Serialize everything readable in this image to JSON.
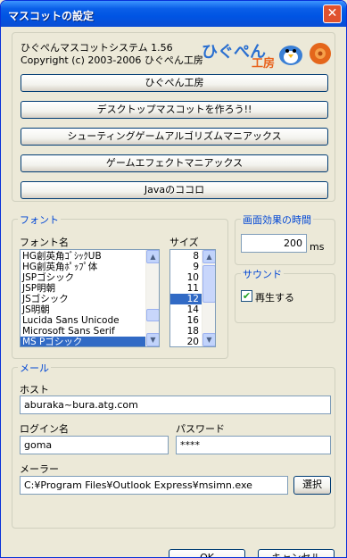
{
  "window": {
    "title": "マスコットの設定",
    "close": "✕"
  },
  "about": {
    "app_name": "ひぐぺんマスコットシステム 1.56",
    "copyright": "Copyright (c) 2003-2006 ひぐぺん工房",
    "logo_text_1": "ひぐぺん",
    "logo_text_2": "工房",
    "buttons": [
      "ひぐぺん工房",
      "デスクトップマスコットを作ろう!!",
      "シューティングゲームアルゴリズムマニアックス",
      "ゲームエフェクトマニアックス",
      "Javaのココロ"
    ]
  },
  "font": {
    "group_label": "フォント",
    "name_label": "フォント名",
    "size_label": "サイズ",
    "fonts": [
      "HG創英角ｺﾞｼｯｸUB",
      "HG創英角ﾎﾟｯﾌﾟ体",
      "JSPゴシック",
      "JSP明朝",
      "JSゴシック",
      "JS明朝",
      "Lucida Sans Unicode",
      "Microsoft Sans Serif",
      "MS Pゴシック"
    ],
    "selected_font": "MS Pゴシック",
    "sizes": [
      "8",
      "9",
      "10",
      "11",
      "12",
      "14",
      "16",
      "18",
      "20"
    ],
    "selected_size": "12"
  },
  "effect": {
    "group_label": "画面効果の時間",
    "value": "200",
    "unit": "ms"
  },
  "sound": {
    "group_label": "サウンド",
    "play_label": "再生する",
    "checked": true
  },
  "mail": {
    "group_label": "メール",
    "host_label": "ホスト",
    "host_value": "aburaka~bura.atg.com",
    "login_label": "ログイン名",
    "login_value": "goma",
    "password_label": "パスワード",
    "password_value": "****",
    "mailer_label": "メーラー",
    "mailer_value": "C:¥Program Files¥Outlook Express¥msimn.exe",
    "select_button": "選択"
  },
  "footer": {
    "ok": "OK",
    "cancel": "キャンセル"
  }
}
